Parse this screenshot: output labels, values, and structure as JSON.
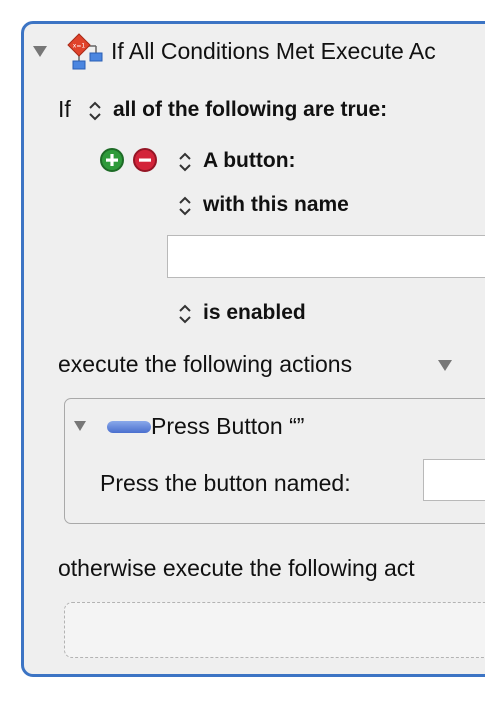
{
  "action": {
    "title": "If All Conditions Met Execute Ac",
    "condition_prefix": "If",
    "condition_mode": "all of the following are true:",
    "condition": {
      "type": "A button:",
      "criteria": "with this name",
      "name_value": "",
      "state": "is enabled"
    },
    "then_label": "execute the following actions",
    "nested_action": {
      "title": "Press Button “”",
      "field_label": "Press the button named:",
      "field_value": ""
    },
    "else_label": "otherwise execute the following act"
  },
  "icons": {
    "header": "flowchart-icon",
    "add": "plus-circle-icon",
    "remove": "minus-circle-icon",
    "nested": "button-pill-icon"
  },
  "colors": {
    "panel_border": "#3c74c4",
    "panel_bg": "#efefef",
    "add_green": "#2e9a3a",
    "remove_red": "#d3243a",
    "pill_blue": "#5b7fd8"
  }
}
